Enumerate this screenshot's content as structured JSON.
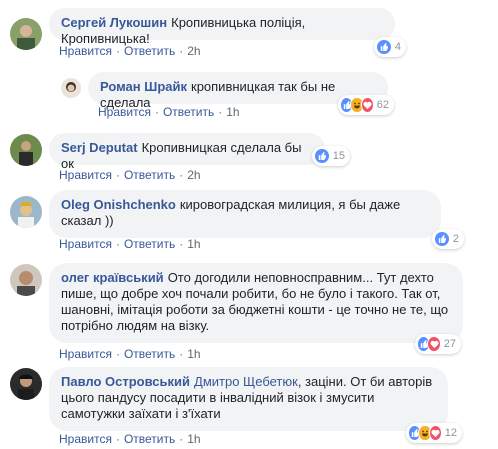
{
  "comments": [
    {
      "author": "Сергей Лукошин",
      "text": "Кропивницька поліція, Кропивницька!",
      "like_label": "Нравится",
      "reply_label": "Ответить",
      "time": "2h",
      "reactions": [
        "like"
      ],
      "reaction_count": "4"
    },
    {
      "author": "Роман Шрайк",
      "text": "кропивницкая так бы не сделала",
      "like_label": "Нравится",
      "reply_label": "Ответить",
      "time": "1h",
      "reactions": [
        "like",
        "haha",
        "love"
      ],
      "reaction_count": "62"
    },
    {
      "author": "Serj Deputat",
      "text": "Кропивницкая сделала бы ок",
      "like_label": "Нравится",
      "reply_label": "Ответить",
      "time": "2h",
      "reactions": [
        "like"
      ],
      "reaction_count": "15"
    },
    {
      "author": "Oleg Onishchenko",
      "text": "кировоградская милиция, я бы даже сказал ))",
      "like_label": "Нравится",
      "reply_label": "Ответить",
      "time": "1h",
      "reactions": [
        "like"
      ],
      "reaction_count": "2"
    },
    {
      "author": "олег краївський",
      "text": "Ото догодили неповносправним... Тут дехто пише, що добре хоч почали робити, бо не було і такого. Так от, шановні, імітація роботи за бюджетні кошти - це точно не те, що потрібно людям на візку.",
      "like_label": "Нравится",
      "reply_label": "Ответить",
      "time": "1h",
      "reactions": [
        "like",
        "love"
      ],
      "reaction_count": "27"
    },
    {
      "author": "Павло Островський",
      "tag": "Дмитро Щебетюк",
      "text": ", заціни. От би авторів цього пандусу посадити в інвалідний візок і змусити самотужки заїхати і з'їхати",
      "like_label": "Нравится",
      "reply_label": "Ответить",
      "time": "1h",
      "reactions": [
        "like",
        "haha",
        "love"
      ],
      "reaction_count": "12"
    }
  ],
  "colors": {
    "link": "#385898",
    "bubble": "#f2f3f5",
    "like": "#5890ff",
    "haha": "#f7b125",
    "love": "#f25268"
  }
}
